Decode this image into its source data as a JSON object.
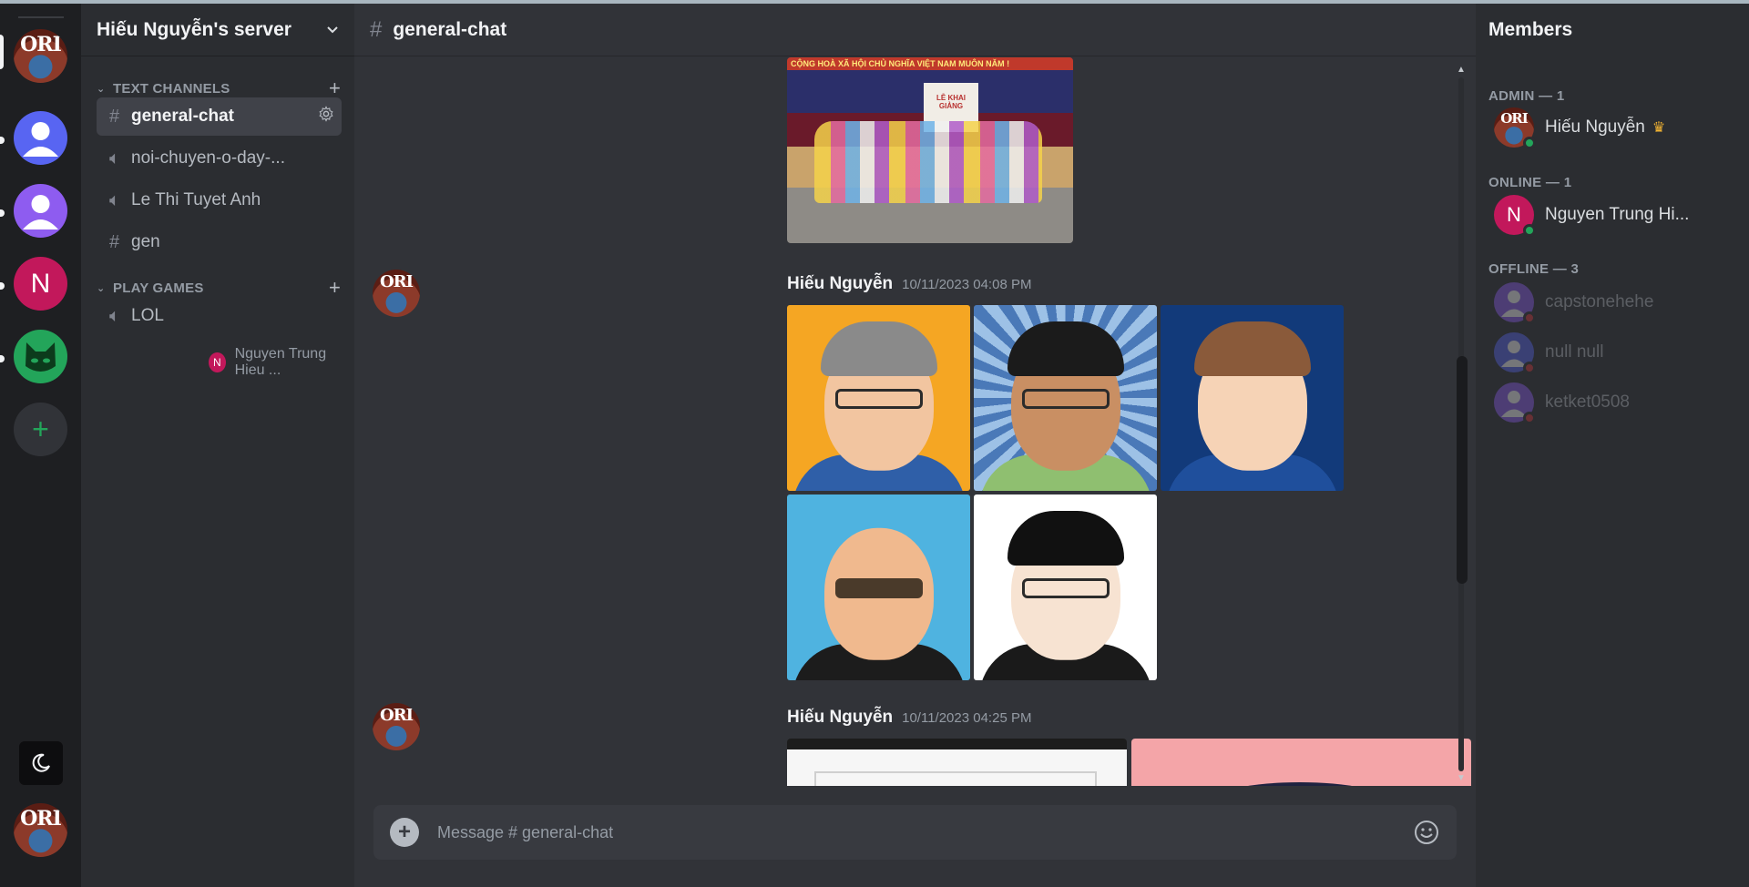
{
  "server": {
    "name": "Hiếu Nguyễn's server"
  },
  "categories": [
    {
      "label": "TEXT CHANNELS"
    },
    {
      "label": "PLAY GAMES"
    }
  ],
  "channels": [
    {
      "name": "general-chat",
      "type": "text",
      "icon": "hash-icon"
    },
    {
      "name": "noi-chuyen-o-day-...",
      "type": "voice",
      "icon": "speaker-icon"
    },
    {
      "name": "Le Thi Tuyet Anh",
      "type": "voice",
      "icon": "speaker-icon"
    },
    {
      "name": "gen",
      "type": "text",
      "icon": "hash-icon"
    },
    {
      "name": "LOL",
      "type": "voice",
      "icon": "speaker-icon"
    }
  ],
  "voice_user": {
    "initial": "N",
    "name": "Nguyen Trung Hieu ..."
  },
  "rail": {
    "n_initial": "N"
  },
  "chat": {
    "channel": "general-chat",
    "messages": [
      {
        "author": "Hiếu Nguyễn",
        "time": "10/11/2023 04:08 PM",
        "attachments": 5
      },
      {
        "author": "Hiếu Nguyễn",
        "time": "10/11/2023 04:25 PM",
        "attachments": 2
      }
    ],
    "photo_banner": "CỘNG HOÀ XÃ HỘI CHỦ NGHĨA VIỆT NAM MUÔN NĂM !",
    "photo_sign": "LỄ KHAI GIẢNG",
    "composer_placeholder": "Message # general-chat"
  },
  "members": {
    "title": "Members",
    "groups": [
      {
        "label": "ADMIN — 1"
      },
      {
        "label": "ONLINE — 1"
      },
      {
        "label": "OFFLINE — 3"
      }
    ],
    "list": [
      {
        "name": "Hiếu Nguyễn",
        "status": "online"
      },
      {
        "name": "Nguyen Trung Hi...",
        "initial": "N",
        "status": "online"
      },
      {
        "name": "capstonehehe",
        "status": "offline"
      },
      {
        "name": "null null",
        "status": "offline"
      },
      {
        "name": "ketket0508",
        "status": "offline"
      }
    ]
  },
  "colors": {
    "online": "#23a55a",
    "offline": "#da373c",
    "accent": "#5865f2"
  }
}
